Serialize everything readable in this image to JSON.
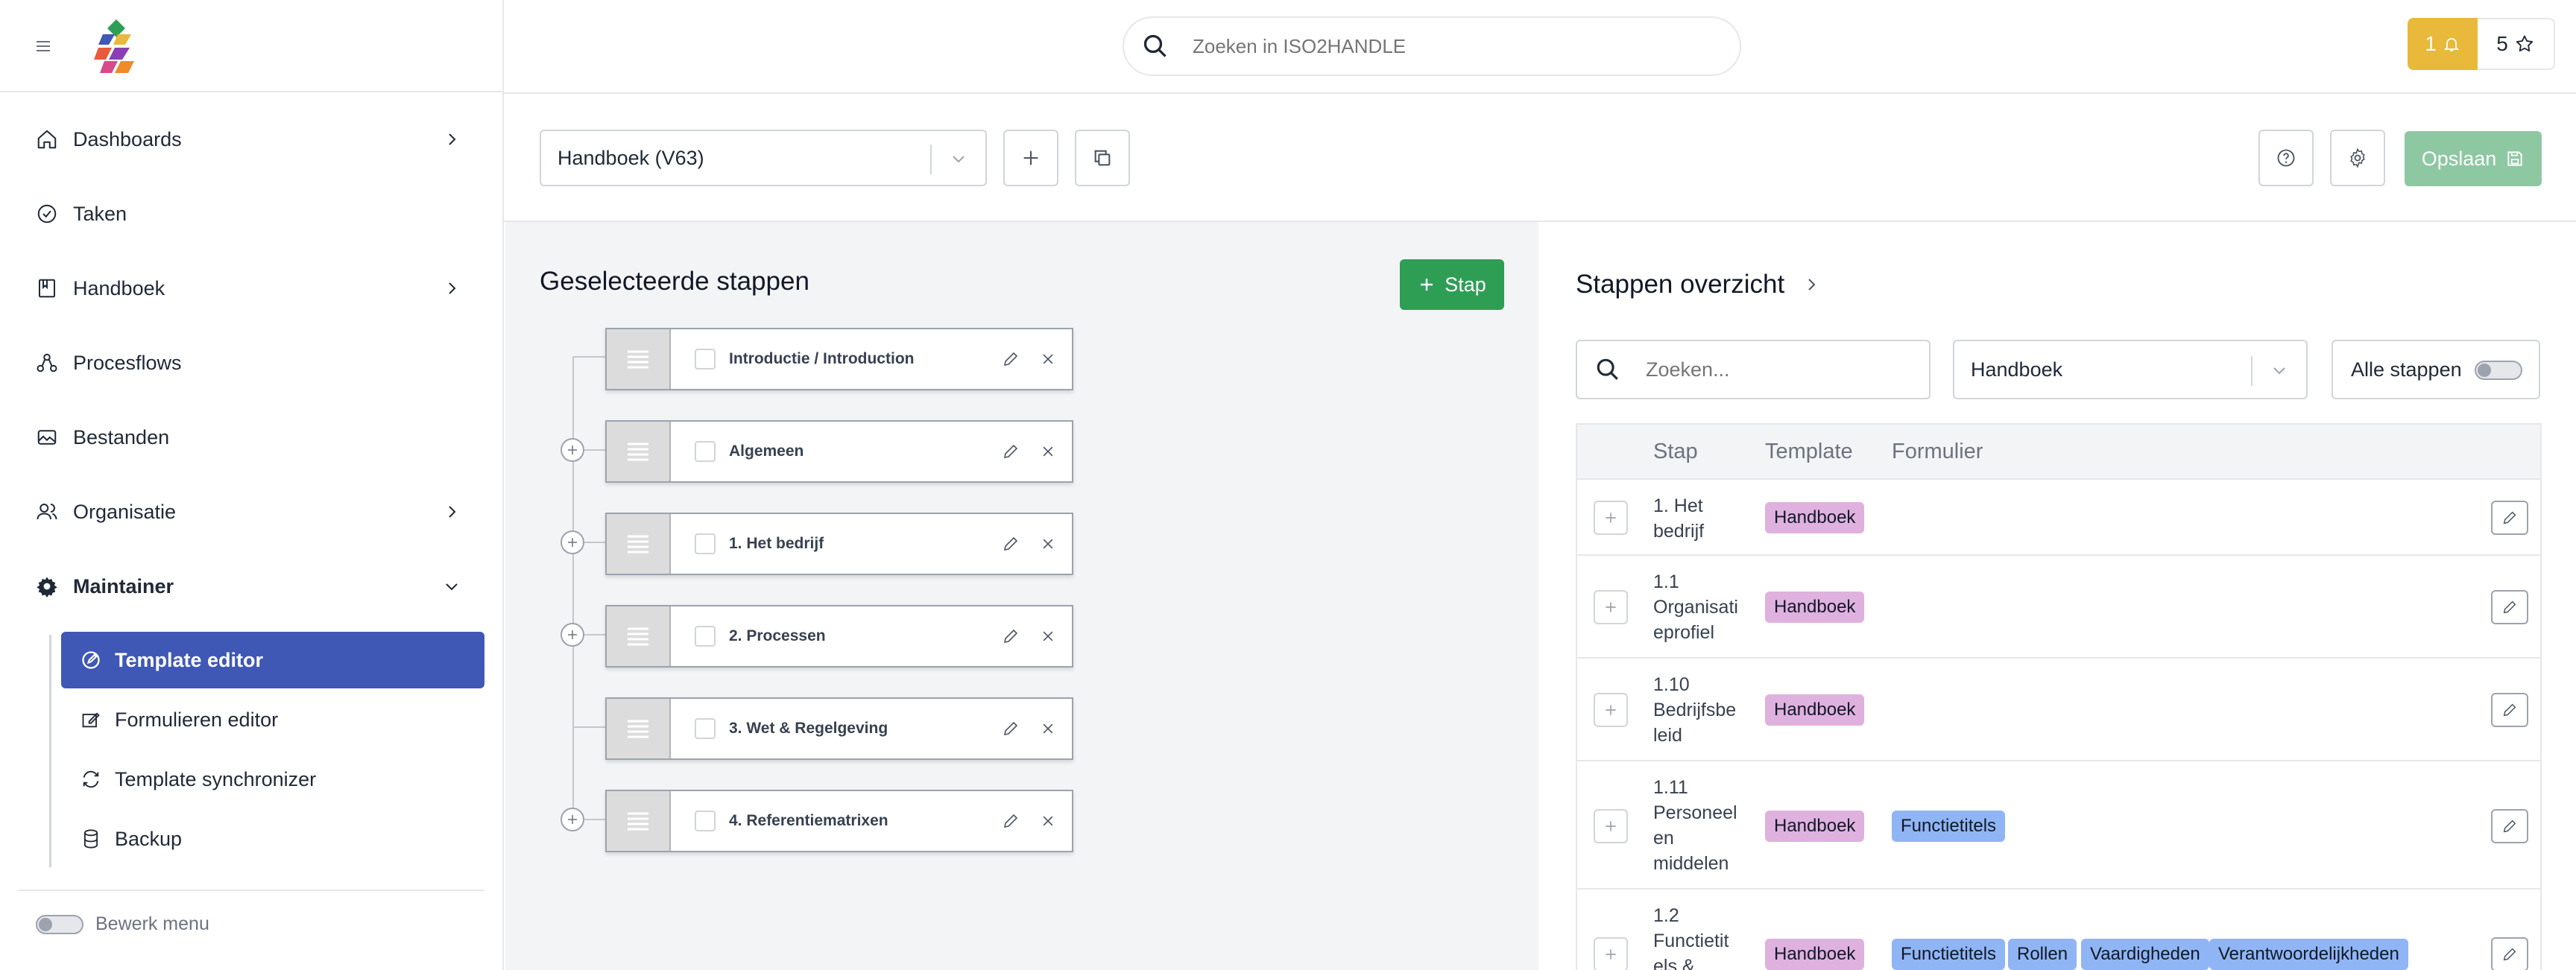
{
  "app": {
    "brand": "ISO2HANDLE"
  },
  "sidebar": {
    "items": [
      {
        "label": "Dashboards",
        "icon": "home-icon",
        "has_chevron": true
      },
      {
        "label": "Taken",
        "icon": "check-circle-icon",
        "has_chevron": false
      },
      {
        "label": "Handboek",
        "icon": "book-icon",
        "has_chevron": true
      },
      {
        "label": "Procesflows",
        "icon": "flow-icon",
        "has_chevron": false
      },
      {
        "label": "Bestanden",
        "icon": "images-icon",
        "has_chevron": false
      },
      {
        "label": "Organisatie",
        "icon": "users-icon",
        "has_chevron": true
      },
      {
        "label": "Maintainer",
        "icon": "gear-icon",
        "has_chevron": true,
        "expanded": true
      }
    ],
    "sub_items": [
      {
        "label": "Template editor",
        "icon": "edit-circle-icon",
        "active": true
      },
      {
        "label": "Formulieren editor",
        "icon": "form-edit-icon",
        "active": false
      },
      {
        "label": "Template synchronizer",
        "icon": "sync-icon",
        "active": false
      },
      {
        "label": "Backup",
        "icon": "database-icon",
        "active": false
      }
    ],
    "bewerk_menu_label": "Bewerk menu"
  },
  "topbar": {
    "search_placeholder": "Zoeken in ISO2HANDLE",
    "notifications_count": "1",
    "favorites_count": "5",
    "notification_color": "#e8b93a"
  },
  "toolbar": {
    "handboek_select": "Handboek (V63)",
    "save_label": "Opslaan",
    "save_color": "#8ec8a2"
  },
  "selected_steps": {
    "title": "Geselecteerde stappen",
    "add_label": "Stap",
    "add_color": "#2f9e55",
    "steps": [
      {
        "label": "Introductie / Introduction"
      },
      {
        "label": "Algemeen"
      },
      {
        "label": "1. Het bedrijf"
      },
      {
        "label": "2. Processen"
      },
      {
        "label": "3. Wet & Regelgeving"
      },
      {
        "label": "4. Referentiematrixen"
      }
    ]
  },
  "overview": {
    "title": "Stappen overzicht",
    "search_placeholder": "Zoeken...",
    "filter_select": "Handboek",
    "all_steps_label": "Alle stappen",
    "columns": [
      "Stap",
      "Template",
      "Formulier"
    ],
    "rows": [
      {
        "stap_lines": [
          "1. Het",
          "bedrijf"
        ],
        "template": "Handboek",
        "forms": []
      },
      {
        "stap_lines": [
          "1.1",
          "Organisati",
          "eprofiel"
        ],
        "template": "Handboek",
        "forms": []
      },
      {
        "stap_lines": [
          "1.10",
          "Bedrijfsbe",
          "leid"
        ],
        "template": "Handboek",
        "forms": []
      },
      {
        "stap_lines": [
          "1.11",
          "Personeel",
          "en",
          "middelen"
        ],
        "template": "Handboek",
        "forms": [
          "Functietitels"
        ]
      },
      {
        "stap_lines": [
          "1.2",
          "Functietit",
          "els &"
        ],
        "template": "Handboek",
        "forms": [
          "Functietitels",
          "Rollen",
          "Vaardigheden",
          "Verantwoordelijkheden"
        ]
      }
    ],
    "template_badge_color": "#dfb1de",
    "form_badge_color": "#90b5f5"
  }
}
